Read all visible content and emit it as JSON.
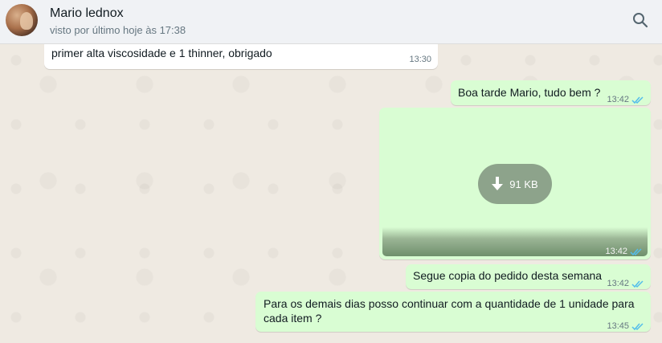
{
  "header": {
    "contact_name": "Mario lednox",
    "status": "visto por último hoje às 17:38",
    "search_icon": "search-icon"
  },
  "messages": [
    {
      "direction": "incoming",
      "text": "primer alta viscosidade e 1 thinner, obrigado",
      "time": "13:30"
    },
    {
      "direction": "outgoing",
      "text": "Boa tarde Mario, tudo bem ?",
      "time": "13:42",
      "ticks": "read"
    },
    {
      "direction": "outgoing",
      "type": "document",
      "download_size": "91 KB",
      "time": "13:42",
      "ticks": "read"
    },
    {
      "direction": "outgoing",
      "text": "Segue copia do pedido desta semana",
      "time": "13:42",
      "ticks": "read"
    },
    {
      "direction": "outgoing",
      "text_line1": "Para os demais dias posso continuar com a quantidade de 1 unidade para",
      "text_line2": "cada item ?",
      "time": "13:45",
      "ticks": "read"
    }
  ],
  "colors": {
    "outgoing_bubble": "#d9fdd3",
    "incoming_bubble": "#ffffff",
    "read_ticks": "#53bdeb",
    "chat_background": "#efeae2"
  }
}
